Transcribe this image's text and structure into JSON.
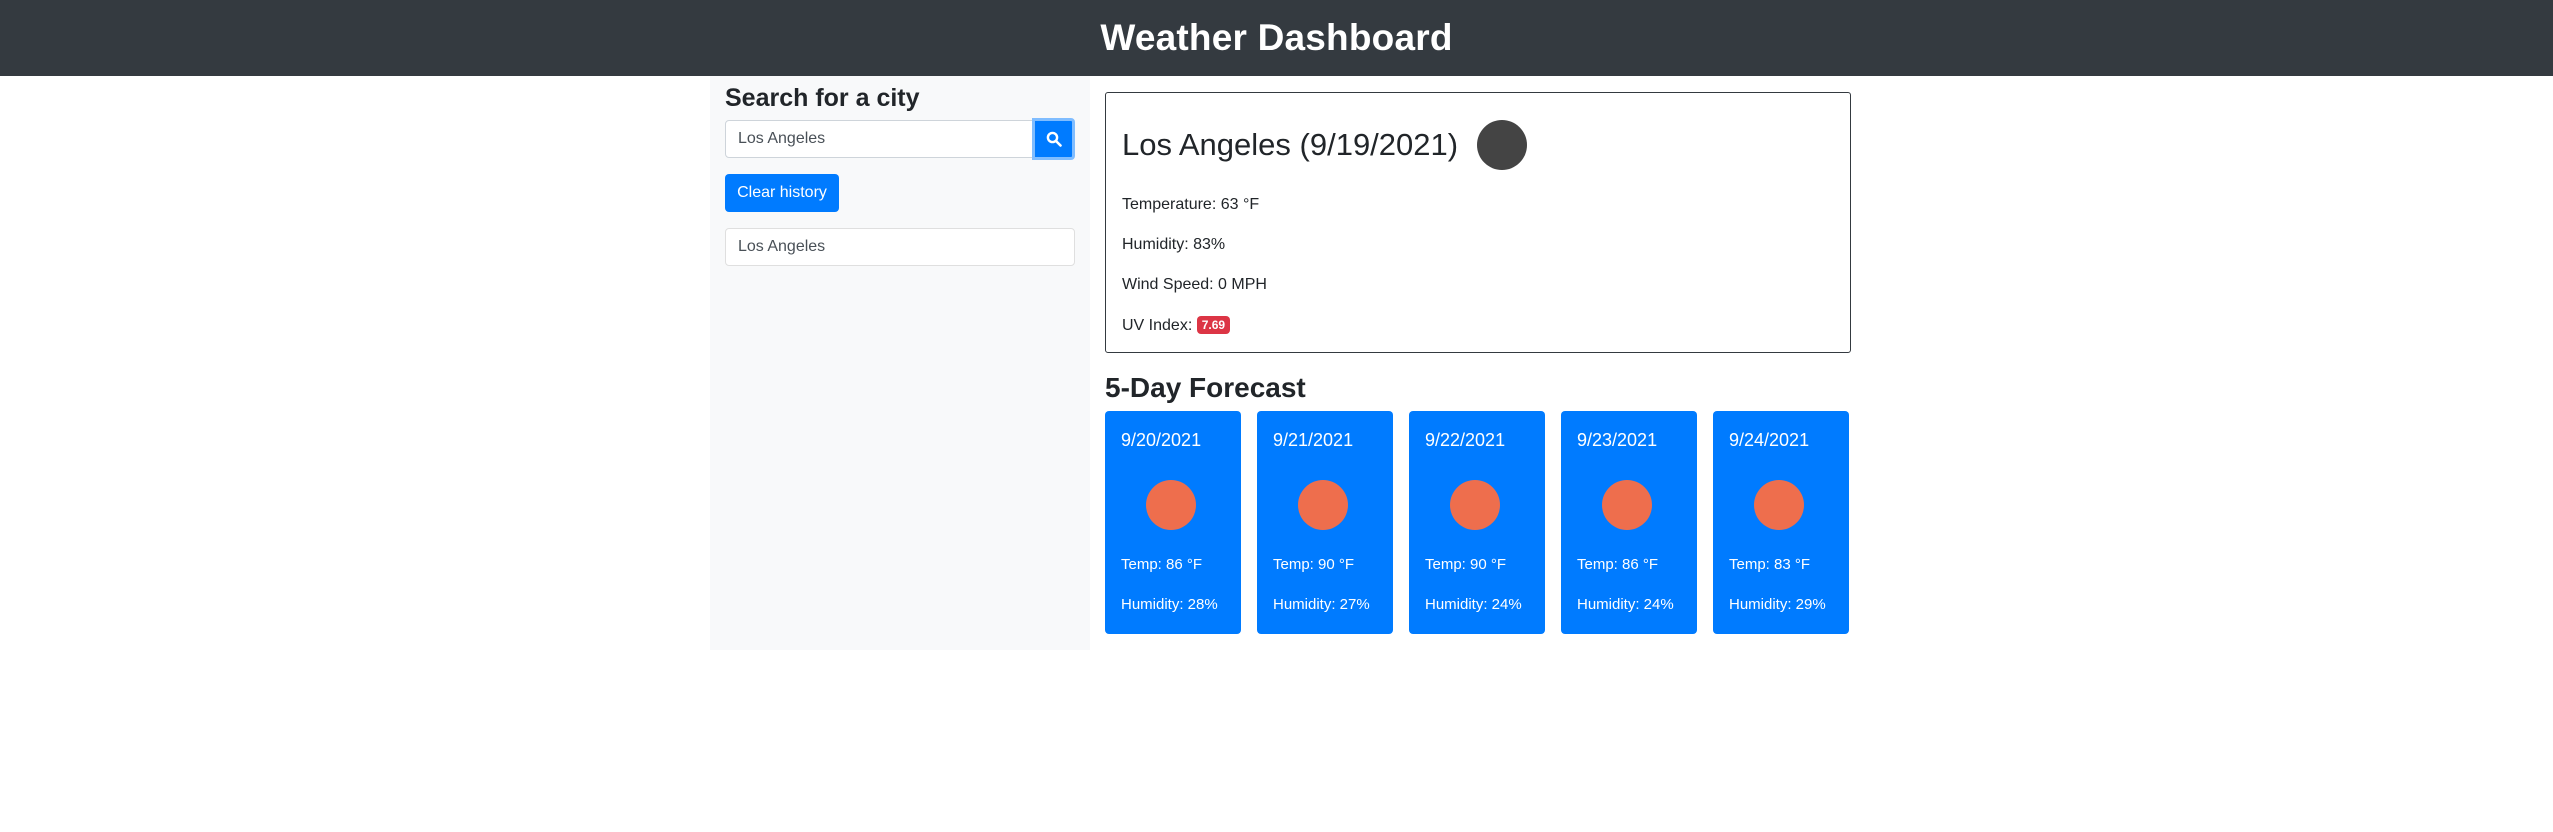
{
  "header": {
    "title": "Weather Dashboard"
  },
  "search": {
    "title": "Search for a city",
    "value": "Los Angeles",
    "clear_label": "Clear history"
  },
  "history": [
    {
      "label": "Los Angeles"
    }
  ],
  "current": {
    "title": "Los Angeles (9/19/2021)",
    "temperature": "Temperature: 63 °F",
    "humidity": "Humidity: 83%",
    "wind": "Wind Speed: 0 MPH",
    "uv_label": "UV Index:",
    "uv_value": "7.69",
    "icon": "weather-icon"
  },
  "forecast": {
    "title": "5-Day Forecast",
    "days": [
      {
        "date": "9/20/2021",
        "temp": "Temp: 86 °F",
        "humidity": "Humidity: 28%"
      },
      {
        "date": "9/21/2021",
        "temp": "Temp: 90 °F",
        "humidity": "Humidity: 27%"
      },
      {
        "date": "9/22/2021",
        "temp": "Temp: 90 °F",
        "humidity": "Humidity: 24%"
      },
      {
        "date": "9/23/2021",
        "temp": "Temp: 86 °F",
        "humidity": "Humidity: 24%"
      },
      {
        "date": "9/24/2021",
        "temp": "Temp: 83 °F",
        "humidity": "Humidity: 29%"
      }
    ]
  },
  "colors": {
    "header_bg": "#343a40",
    "primary": "#007bff",
    "uv_badge": "#dc3545",
    "sidebar_bg": "#f8f9fa",
    "sun_icon": "#ee6e4d",
    "current_icon": "#444444"
  }
}
